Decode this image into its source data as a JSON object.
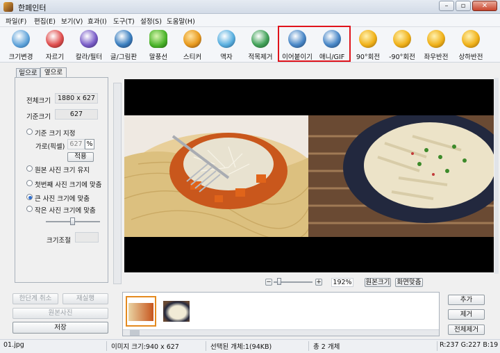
{
  "window": {
    "title": "한페인터"
  },
  "menu": [
    "파일(F)",
    "편집(E)",
    "보기(V)",
    "효과(I)",
    "도구(T)",
    "설정(S)",
    "도움말(H)"
  ],
  "toolbar": [
    {
      "label": "크기변경",
      "icon": "resize-icon"
    },
    {
      "label": "자르기",
      "icon": "crop-icon"
    },
    {
      "label": "칼라/필터",
      "icon": "color-filter-icon"
    },
    {
      "label": "글/그림판",
      "icon": "text-paint-icon"
    },
    {
      "label": "말풍선",
      "icon": "speech-bubble-icon"
    },
    {
      "label": "스티커",
      "icon": "sticker-icon"
    },
    {
      "label": "액자",
      "icon": "frame-icon"
    },
    {
      "label": "적목제거",
      "icon": "red-eye-icon"
    },
    {
      "label": "이어붙이기",
      "icon": "join-images-icon"
    },
    {
      "label": "애니/GIF",
      "icon": "gif-icon"
    },
    {
      "label": "90°회전",
      "icon": "rotate-cw-icon"
    },
    {
      "label": "-90°회전",
      "icon": "rotate-ccw-icon"
    },
    {
      "label": "좌우반전",
      "icon": "flip-horizontal-icon"
    },
    {
      "label": "상하반전",
      "icon": "flip-vertical-icon"
    }
  ],
  "left_panel": {
    "tabs": [
      "밑으로",
      "옆으로"
    ],
    "active_tab": "옆으로",
    "total_size_label": "전체크기",
    "total_size_value": "1880 x 627",
    "base_size_label": "기준크기",
    "base_size_value": "627",
    "option_set_base": "기준 크기 지정",
    "width_label": "가로(픽셀)",
    "width_value": "627",
    "percent_symbol": "%",
    "apply_button": "적용",
    "option_keep_original": "원본 사진 크기 유지",
    "option_fit_first": "첫번째 사진 크기에 맞춤",
    "option_fit_large": "큰 사진 크기에 맞춤",
    "option_fit_small": "작은 사진 크기에 맞춤",
    "selected_option": "큰 사진 크기에 맞춤",
    "size_adjust_label": "크기조절"
  },
  "bottom_left": {
    "undo": "한단계 취소",
    "redo": "재실행",
    "original": "원본사진",
    "save": "저장"
  },
  "zoom": {
    "minus": "−",
    "plus": "+",
    "value": "192%",
    "original_size_button": "원본크기",
    "fit_screen_button": "화면맞춤"
  },
  "right_buttons": {
    "add": "추가",
    "remove": "제거",
    "remove_all": "전체제거"
  },
  "status": {
    "file": "01.jpg",
    "image_size": "이미지 크기:940 x 627",
    "selected": "선택된 개체:1(94KB)",
    "total": "총 2 개체",
    "pixel": "R:237 G:227 B:19"
  },
  "colors": {
    "highlight": "#e0131b",
    "canvas": "#000000"
  }
}
